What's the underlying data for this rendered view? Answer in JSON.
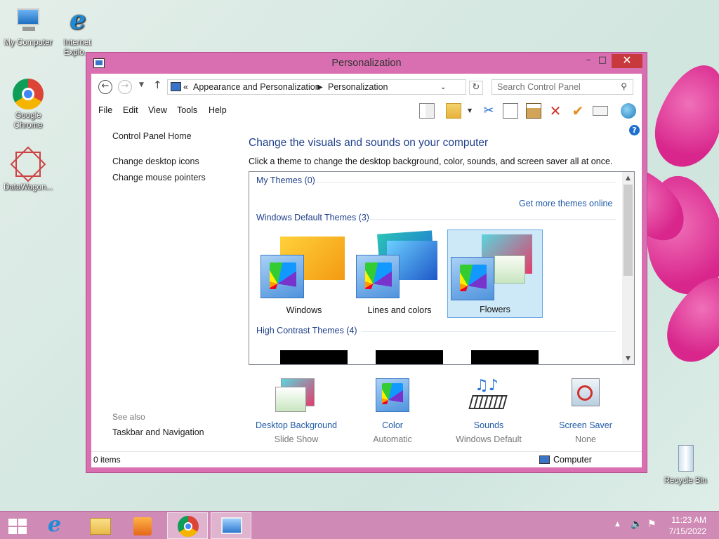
{
  "desktop": {
    "icons": [
      {
        "label": "My Computer"
      },
      {
        "label": "Internet Explo..."
      },
      {
        "label": "Google Chrome"
      },
      {
        "label": "DataWagon..."
      },
      {
        "label": "Recycle Bin"
      }
    ]
  },
  "window": {
    "title": "Personalization",
    "controls": {
      "minimize": "–",
      "maximize": "□",
      "close": "✕"
    },
    "address": {
      "overflow": "«",
      "crumbs": [
        "Appearance and Personalization",
        "Personalization"
      ]
    },
    "search": {
      "placeholder": "Search Control Panel"
    },
    "menu": [
      "File",
      "Edit",
      "View",
      "Tools",
      "Help"
    ],
    "left_panel": {
      "links": [
        "Control Panel Home",
        "Change desktop icons",
        "Change mouse pointers"
      ],
      "see_also_label": "See also",
      "see_also_links": [
        "Taskbar and Navigation"
      ]
    },
    "main": {
      "heading": "Change the visuals and sounds on your computer",
      "subheading": "Click a theme to change the desktop background, color, sounds, and screen saver all at once.",
      "groups": {
        "my_themes": "My Themes (0)",
        "get_more": "Get more themes online",
        "default_themes": "Windows Default Themes (3)",
        "high_contrast": "High Contrast Themes (4)"
      },
      "themes": [
        {
          "name": "Windows",
          "selected": false
        },
        {
          "name": "Lines and colors",
          "selected": false
        },
        {
          "name": "Flowers",
          "selected": true
        }
      ]
    },
    "options": [
      {
        "label": "Desktop Background",
        "value": "Slide Show"
      },
      {
        "label": "Color",
        "value": "Automatic"
      },
      {
        "label": "Sounds",
        "value": "Windows Default"
      },
      {
        "label": "Screen Saver",
        "value": "None"
      }
    ],
    "status": {
      "items": "0 items",
      "location": "Computer"
    }
  },
  "taskbar": {
    "time": "11:23 AM",
    "date": "7/15/2022"
  },
  "colors": {
    "window_frame": "#d96fb0",
    "taskbar": "#cf8bb5",
    "link": "#1f5aa8",
    "heading": "#1e3f8a"
  }
}
